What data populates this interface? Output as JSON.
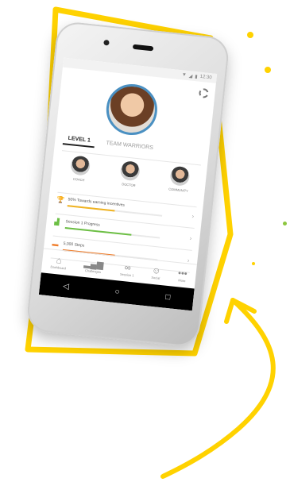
{
  "app": {
    "tabs": [
      {
        "label": "LEVEL 1"
      },
      {
        "label": "TEAM WARRIORS"
      }
    ],
    "team": [
      {
        "name": "COACH"
      },
      {
        "name": "DOCTOR"
      },
      {
        "name": "COMMUNITY"
      }
    ],
    "progress": [
      {
        "label": "50% Towards earning incentives",
        "color": "#f0b321",
        "value_pct": 50
      },
      {
        "label": "Session 1 Progress",
        "color": "#6cbf44",
        "value_pct": 70
      },
      {
        "label": "5,000 Steps",
        "color": "#f07d2a",
        "value_pct": 55
      }
    ],
    "nav": [
      {
        "label": "Dashboard",
        "icon": "home-icon"
      },
      {
        "label": "Challenges",
        "icon": "bar-chart-icon"
      },
      {
        "label": "Session 1",
        "icon": "infinity-icon"
      },
      {
        "label": "Social",
        "icon": "chat-icon"
      },
      {
        "label": "More",
        "icon": "more-icon"
      }
    ],
    "status_time": "12:30"
  },
  "colors": {
    "accent_yellow": "#ffd200",
    "dot_green": "#8cc63f",
    "dot_orange": "#f07d2a",
    "avatar_ring": "#4a90c2"
  }
}
